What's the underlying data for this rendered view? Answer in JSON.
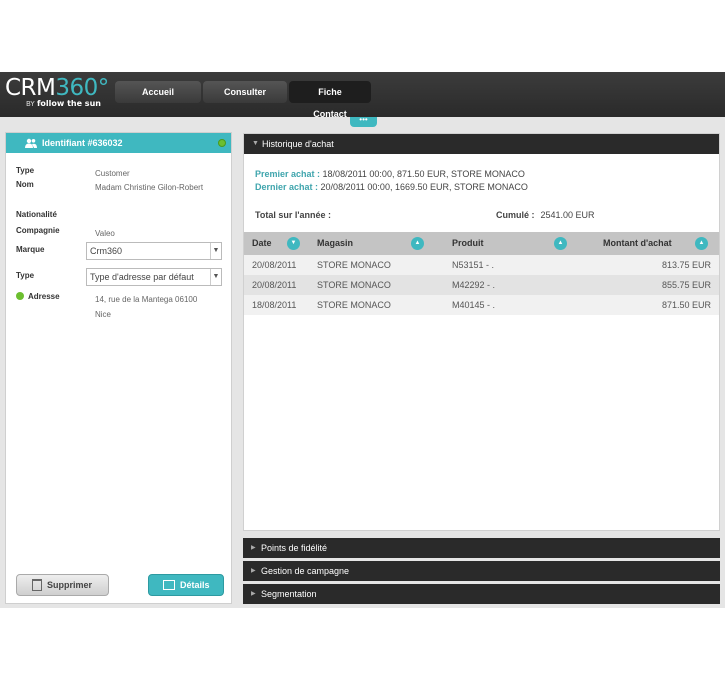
{
  "header": {
    "logo_main": "CRM",
    "logo_num": "360°",
    "logo_by": "BY",
    "logo_sub": "follow the sun",
    "tabs": [
      {
        "label": "Accueil"
      },
      {
        "label": "Consulter"
      },
      {
        "label": "Fiche Contact"
      }
    ],
    "dots": "•••"
  },
  "contact": {
    "header_label": "Identifiant",
    "id": "#636032",
    "fields": {
      "type_label": "Type",
      "type_value": "Customer",
      "nom_label": "Nom",
      "nom_value": "Madam Christine Gilon-Robert",
      "nat_label": "Nationalité",
      "comp_label": "Compagnie",
      "comp_value": "Valeo",
      "marque_label": "Marque",
      "marque_value": "Crm360",
      "addr_type_label": "Type",
      "addr_type_value": "Type d'adresse par défaut",
      "adresse_label": "Adresse",
      "adresse_value": "14, rue de la Mantega 06100 Nice"
    },
    "buttons": {
      "delete": "Supprimer",
      "details": "Détails"
    }
  },
  "history": {
    "title": "Historique d'achat",
    "first_label": "Premier achat :",
    "first_value": "18/08/2011 00:00, 871.50 EUR, STORE MONACO",
    "last_label": "Dernier achat :",
    "last_value": "20/08/2011 00:00, 1669.50 EUR, STORE MONACO",
    "total_label": "Total sur l'année :",
    "cumul_label": "Cumulé :",
    "cumul_value": "2541.00 EUR",
    "columns": [
      "Date",
      "Magasin",
      "Produit",
      "Montant d'achat"
    ],
    "rows": [
      {
        "date": "20/08/2011",
        "store": "STORE MONACO",
        "product": "N53151 - .",
        "amount": "813.75 EUR"
      },
      {
        "date": "20/08/2011",
        "store": "STORE MONACO",
        "product": "M42292 - .",
        "amount": "855.75 EUR"
      },
      {
        "date": "18/08/2011",
        "store": "STORE MONACO",
        "product": "M40145 - .",
        "amount": "871.50 EUR"
      }
    ]
  },
  "accordions": [
    {
      "label": "Points de fidélité"
    },
    {
      "label": "Gestion de campagne"
    },
    {
      "label": "Segmentation"
    }
  ],
  "colors": {
    "accent": "#3fb8c0",
    "header": "#2a2a2a",
    "status_green": "#6cbf2f"
  }
}
